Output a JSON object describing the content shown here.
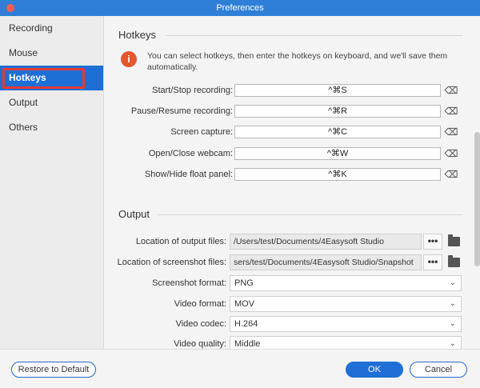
{
  "window": {
    "title": "Preferences"
  },
  "sidebar": {
    "items": [
      {
        "label": "Recording"
      },
      {
        "label": "Mouse"
      },
      {
        "label": "Hotkeys"
      },
      {
        "label": "Output"
      },
      {
        "label": "Others"
      }
    ],
    "selected": "Hotkeys"
  },
  "hotkeys": {
    "title": "Hotkeys",
    "info": "You can select hotkeys, then enter the hotkeys on keyboard, and we'll save them automatically.",
    "rows": [
      {
        "label": "Start/Stop recording:",
        "value": "^⌘S"
      },
      {
        "label": "Pause/Resume recording:",
        "value": "^⌘R"
      },
      {
        "label": "Screen capture:",
        "value": "^⌘C"
      },
      {
        "label": "Open/Close webcam:",
        "value": "^⌘W"
      },
      {
        "label": "Show/Hide float panel:",
        "value": "^⌘K"
      }
    ],
    "clear_glyph": "⌫"
  },
  "output": {
    "title": "Output",
    "output_files_label": "Location of output files:",
    "output_files_value": "/Users/test/Documents/4Easysoft Studio",
    "screenshot_files_label": "Location of screenshot files:",
    "screenshot_files_value": "sers/test/Documents/4Easysoft Studio/Snapshot",
    "browse_label": "•••",
    "screenshot_format_label": "Screenshot format:",
    "screenshot_format_value": "PNG",
    "video_format_label": "Video format:",
    "video_format_value": "MOV",
    "video_codec_label": "Video codec:",
    "video_codec_value": "H.264",
    "video_quality_label": "Video quality:",
    "video_quality_value": "Middle",
    "chevron": "⌄"
  },
  "footer": {
    "restore_label": "Restore to Default",
    "ok_label": "OK",
    "cancel_label": "Cancel"
  },
  "info_icon_glyph": "i",
  "colors": {
    "accent": "#1f6fd7",
    "titlebar": "#2f7fd8",
    "highlight": "#e53935",
    "info": "#e4572e"
  }
}
